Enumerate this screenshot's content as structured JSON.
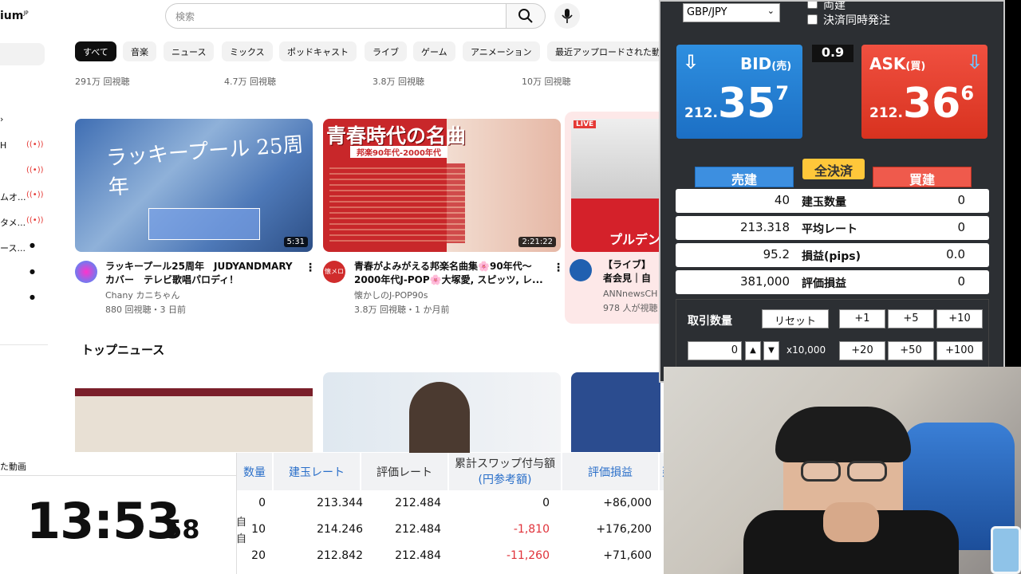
{
  "youtube": {
    "logo_text": "ium",
    "logo_region": "JP",
    "search_placeholder": "検索",
    "chips": [
      "すべて",
      "音楽",
      "ニュース",
      "ミックス",
      "ポッドキャスト",
      "ライブ",
      "ゲーム",
      "アニメーション",
      "最近アップロードされた動"
    ],
    "top_views": [
      "291万 回視聴",
      "4.7万 回視聴",
      "3.8万 回視聴",
      "10万 回視聴"
    ],
    "sidebar": [
      "H",
      "ムオ...",
      "タメ...",
      "ース..."
    ],
    "sidebar_bottom": "た動画",
    "videos": [
      {
        "title1": "ラッキープール25周年　JUDYANDMARY",
        "title2": "カバー　テレビ歌唱パロディ！",
        "channel": "Chany カニちゃん",
        "stats": "880 回視聴・3 日前",
        "duration": "5:31",
        "thumb_text": "ラッキープール 25周年"
      },
      {
        "title1": "青春がよみがえる邦楽名曲集🌸90年代〜",
        "title2": "2000年代J-POP🌸大塚愛, スピッツ, レ...",
        "channel": "懐かしのJ-POP90s",
        "stats": "3.8万 回視聴・1 か月前",
        "duration": "2:21:22",
        "thumb_text": "青春時代の名曲",
        "thumb_sub": "邦楽90年代-2000年代",
        "avatar_text": "懐メロ"
      },
      {
        "title1": "【ライブ】",
        "title2": "者会見｜自",
        "channel": "ANNnewsCH",
        "stats": "978 人が視聴",
        "live": "LIVE",
        "thumb_text": "プルデン"
      }
    ],
    "section_title": "トップニュース"
  },
  "fx": {
    "pair": "GBP/JPY",
    "opt1": "両建",
    "opt2": "決済同時発注",
    "spread": "0.9",
    "bid_label": "BID",
    "bid_sub": "(売)",
    "bid_small": "212.",
    "bid_big": "35",
    "bid_sup": "7",
    "ask_label": "ASK",
    "ask_sub": "(買)",
    "ask_small": "212.",
    "ask_big": "36",
    "ask_sup": "6",
    "sell_tab": "売建",
    "close_all": "全決済",
    "buy_tab": "買建",
    "rows": [
      {
        "left": "40",
        "label": "建玉数量",
        "right": "0"
      },
      {
        "left": "213.318",
        "label": "平均レート",
        "right": "0"
      },
      {
        "left": "95.2",
        "label": "損益(pips)",
        "right": "0.0"
      },
      {
        "left": "381,000",
        "label": "評価損益",
        "right": "0"
      }
    ],
    "qty_label": "取引数量",
    "reset": "リセット",
    "qty_value": "0",
    "multiplier": "x10,000",
    "buttons": [
      "+1",
      "+5",
      "+10",
      "+20",
      "+50",
      "+100"
    ]
  },
  "clock": {
    "time": "13:53",
    "seconds": "58"
  },
  "positions": {
    "headers": [
      "数量",
      "建玉レート",
      "評価レート",
      "累計スワップ付与額",
      "(円参考額)",
      "評価損益",
      "建"
    ],
    "rows": [
      {
        "qty": "0",
        "open": "213.344",
        "eval": "212.484",
        "swap": "0",
        "pl": "+86,000",
        "side": "自"
      },
      {
        "qty": "10",
        "open": "214.246",
        "eval": "212.484",
        "swap": "-1,810",
        "pl": "+176,200",
        "side": "自"
      },
      {
        "qty": "20",
        "open": "212.842",
        "eval": "212.484",
        "swap": "-11,260",
        "pl": "+71,600",
        "side": "自"
      }
    ]
  },
  "colors": {
    "bid": "#1c6fc4",
    "ask": "#d8321f",
    "negative": "#e0323a",
    "header_blue": "#2a6fc9"
  }
}
